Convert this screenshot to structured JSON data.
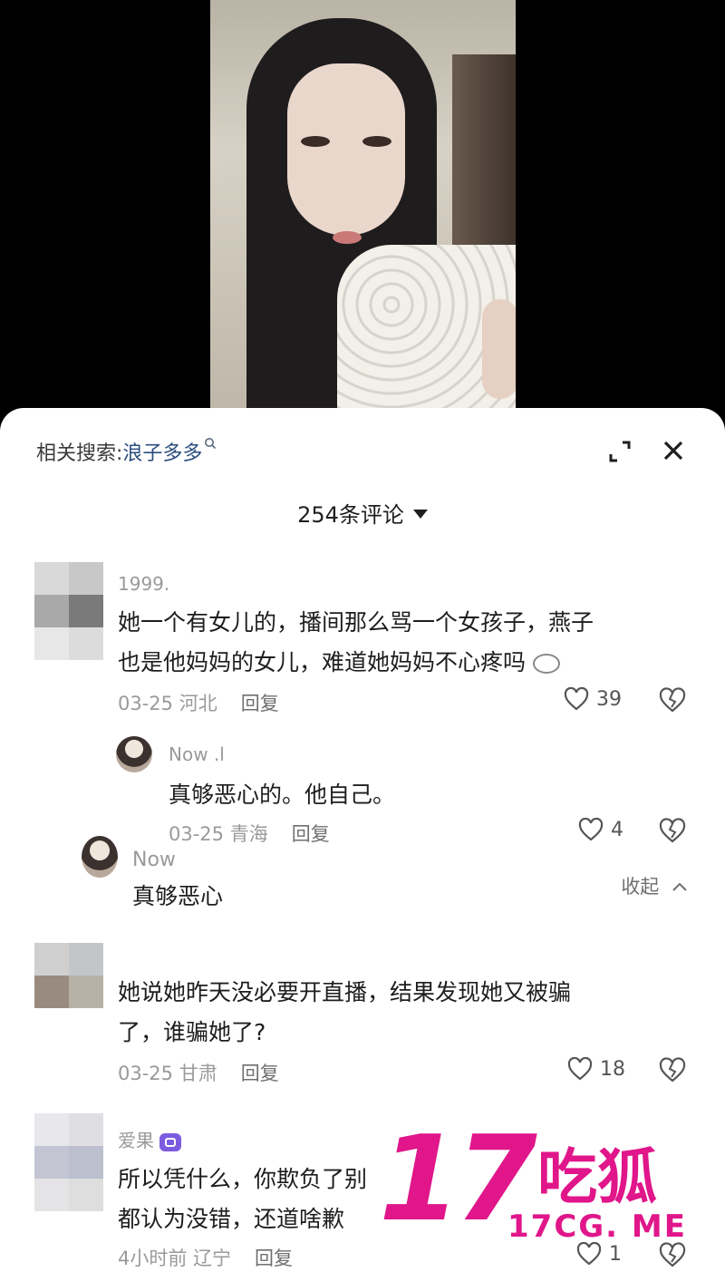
{
  "header": {
    "related_label": "相关搜索:",
    "related_term": "浪子多多",
    "comment_count": "254条评论"
  },
  "comments": [
    {
      "username": "1999.",
      "text_line1": "她一个有女儿的，播间那么骂一个女孩子，燕子",
      "text_line2": "也是他妈妈的女儿，难道她妈妈不心疼吗",
      "date_location": "03-25 河北",
      "reply_label": "回复",
      "likes": "39",
      "replies": [
        {
          "username": "Now .l",
          "text": "真够恶心的。他自己。",
          "date_location": "03-25 青海",
          "reply_label": "回复",
          "likes": "4"
        },
        {
          "username": "Now",
          "text": "真够恶心",
          "collapse_label": "收起"
        }
      ]
    },
    {
      "username": "",
      "text_line1": "她说她昨天没必要开直播，结果发现她又被骗",
      "text_line2": "了，谁骗她了?",
      "date_location": "03-25 甘肃",
      "reply_label": "回复",
      "likes": "18"
    },
    {
      "username": "爱果",
      "text_line1": "所以凭什么，你欺负了别",
      "text_line2": "都认为没错，还道啥歉",
      "date_location": "4小时前 辽宁",
      "reply_label": "回复",
      "likes": "1"
    }
  ],
  "watermark": {
    "number": "17",
    "name": "吃狐",
    "url": "17CG. ME"
  },
  "colors": {
    "watermark": "#e0168a",
    "related_term": "#2b4d7e",
    "badge": "#7c5be0"
  },
  "icons": [
    "search-icon",
    "expand-icon",
    "close-icon",
    "caret-down-icon",
    "heart-icon",
    "dislike-heart-icon",
    "badge-icon"
  ]
}
